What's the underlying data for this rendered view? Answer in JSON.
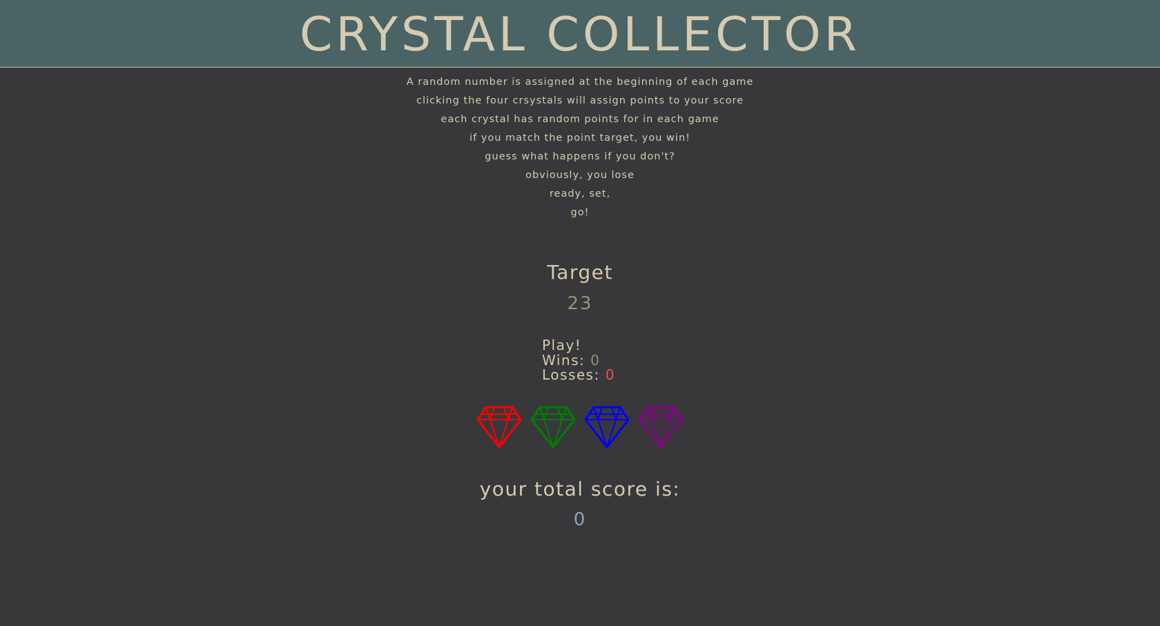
{
  "header": {
    "title": "CRYSTAL COLLECTOR"
  },
  "instructions": [
    "A random number is assigned at the beginning of each game",
    "clicking the four crsystals will assign points to your score",
    "each crystal has random points for in each game",
    "if you match the point target, you win!",
    "guess what happens if you don't?",
    "obviously, you lose",
    "ready, set,",
    "go!"
  ],
  "target": {
    "label": "Target",
    "value": "23"
  },
  "stats": {
    "play_label": "Play!",
    "wins_label": "Wins: ",
    "wins_value": "0",
    "losses_label": "Losses: ",
    "losses_value": "0"
  },
  "crystals": [
    {
      "name": "red-crystal-icon",
      "color": "#ff0000"
    },
    {
      "name": "green-crystal-icon",
      "color": "#008000"
    },
    {
      "name": "blue-crystal-icon",
      "color": "#0000ff"
    },
    {
      "name": "purple-crystal-icon",
      "color": "#8b008b"
    }
  ],
  "score": {
    "label": "your total score is:",
    "value": "0"
  },
  "colors": {
    "background": "#38383a",
    "header": "#4a6465",
    "text": "#d6cbb1",
    "target_value": "#8d9774",
    "wins_value": "#8d9774",
    "losses_value": "#e2574d",
    "score_value": "#8aa7b0"
  }
}
